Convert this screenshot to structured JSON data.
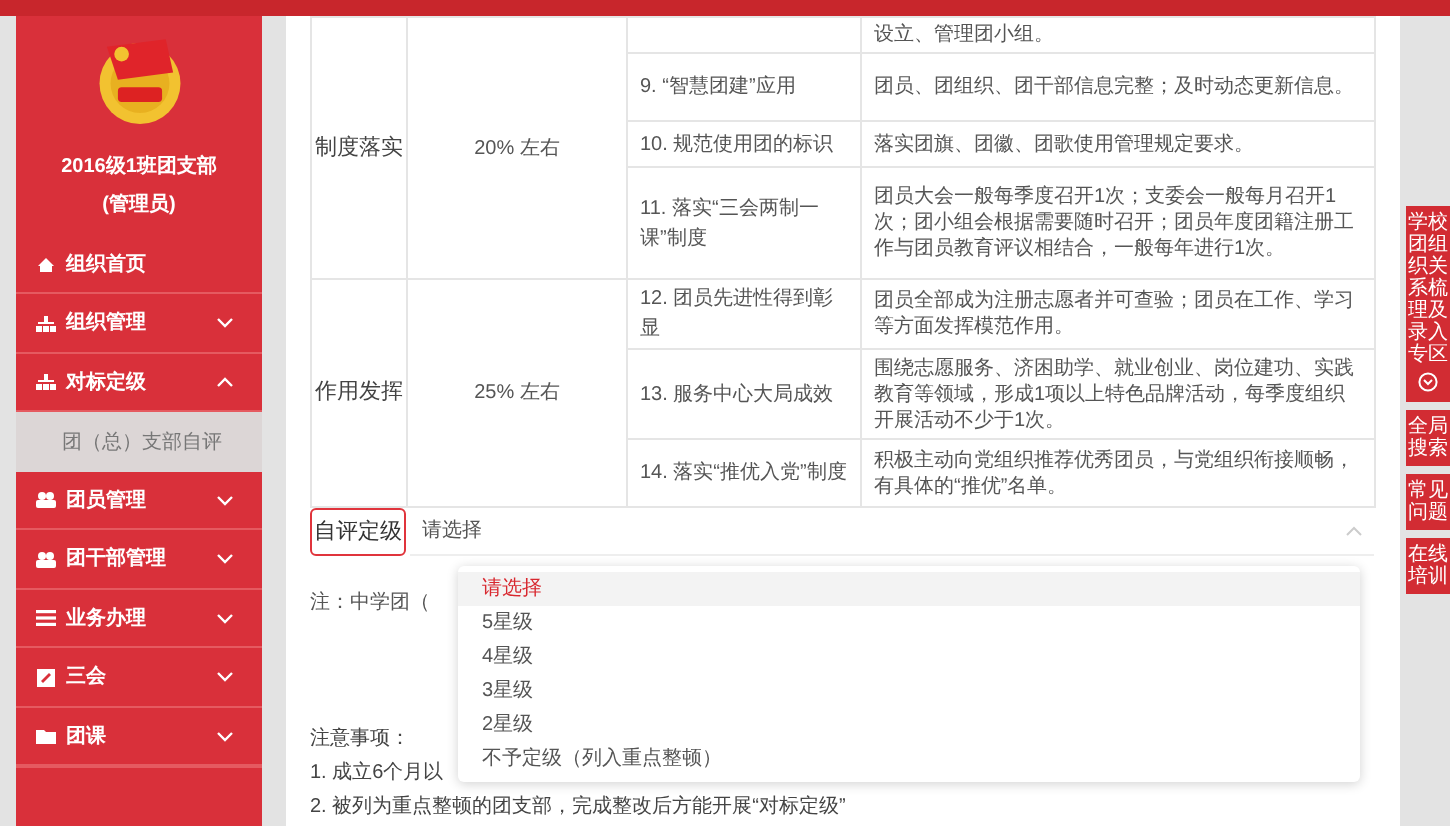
{
  "sidebar": {
    "org_name": "2016级1班团支部",
    "role": "(管理员)",
    "items": [
      {
        "label": "组织首页",
        "kind": "link"
      },
      {
        "label": "组织管理",
        "kind": "group",
        "expanded": false
      },
      {
        "label": "对标定级",
        "kind": "group",
        "expanded": true,
        "children": [
          {
            "label": "团（总）支部自评",
            "selected": true
          }
        ]
      },
      {
        "label": "团员管理",
        "kind": "group",
        "expanded": false
      },
      {
        "label": "团干部管理",
        "kind": "group",
        "expanded": false
      },
      {
        "label": "业务办理",
        "kind": "group",
        "expanded": false
      },
      {
        "label": "三会",
        "kind": "group",
        "expanded": false
      },
      {
        "label": "团课",
        "kind": "group",
        "expanded": false
      }
    ]
  },
  "table": {
    "groups": [
      {
        "category": "制度落实",
        "weight": "20% 左右",
        "items": [
          {
            "standard": "设立、管理团小组。"
          },
          {
            "item": "9. “智慧团建”应用",
            "standard": "团员、团组织、团干部信息完整；及时动态更新信息。"
          },
          {
            "item": "10. 规范使用团的标识",
            "standard": "落实团旗、团徽、团歌使用管理规定要求。"
          },
          {
            "item": "11. 落实“三会两制一课”制度",
            "standard": "团员大会一般每季度召开1次；支委会一般每月召开1次；团小组会根据需要随时召开；团员年度团籍注册工作与团员教育评议相结合，一般每年进行1次。"
          }
        ]
      },
      {
        "category": "作用发挥",
        "weight": "25% 左右",
        "items": [
          {
            "item": "12. 团员先进性得到彰显",
            "standard": "团员全部成为注册志愿者并可查验；团员在工作、学习等方面发挥模范作用。"
          },
          {
            "item": "13. 服务中心大局成效",
            "standard": "围绕志愿服务、济困助学、就业创业、岗位建功、实践教育等领域，形成1项以上特色品牌活动，每季度组织开展活动不少于1次。"
          },
          {
            "item": "14. 落实“推优入党”制度",
            "standard": "积极主动向党组织推荐优秀团员，与党组织衔接顺畅，有具体的“推优”名单。"
          }
        ]
      }
    ]
  },
  "self_rating": {
    "label": "自评定级",
    "placeholder": "请选择",
    "open": true,
    "options": [
      {
        "label": "请选择",
        "selected": true
      },
      {
        "label": "5星级",
        "selected": false
      },
      {
        "label": "4星级",
        "selected": false
      },
      {
        "label": "3星级",
        "selected": false
      },
      {
        "label": "2星级",
        "selected": false
      },
      {
        "label": "不予定级（列入重点整顿）",
        "selected": false
      }
    ]
  },
  "note": "注：中学团（",
  "notices_title": "注意事项：",
  "notices": [
    "1. 成立6个月以",
    "2. 被列为重点整顿的团支部，完成整改后方能开展“对标定级”"
  ],
  "side_buttons": [
    {
      "label": "学校团组织关系梳理及录入专区",
      "kind": "expandable"
    },
    {
      "label": "全局搜索",
      "kind": "plain"
    },
    {
      "label": "常见问题",
      "kind": "plain"
    },
    {
      "label": "在线培训",
      "kind": "plain"
    }
  ]
}
